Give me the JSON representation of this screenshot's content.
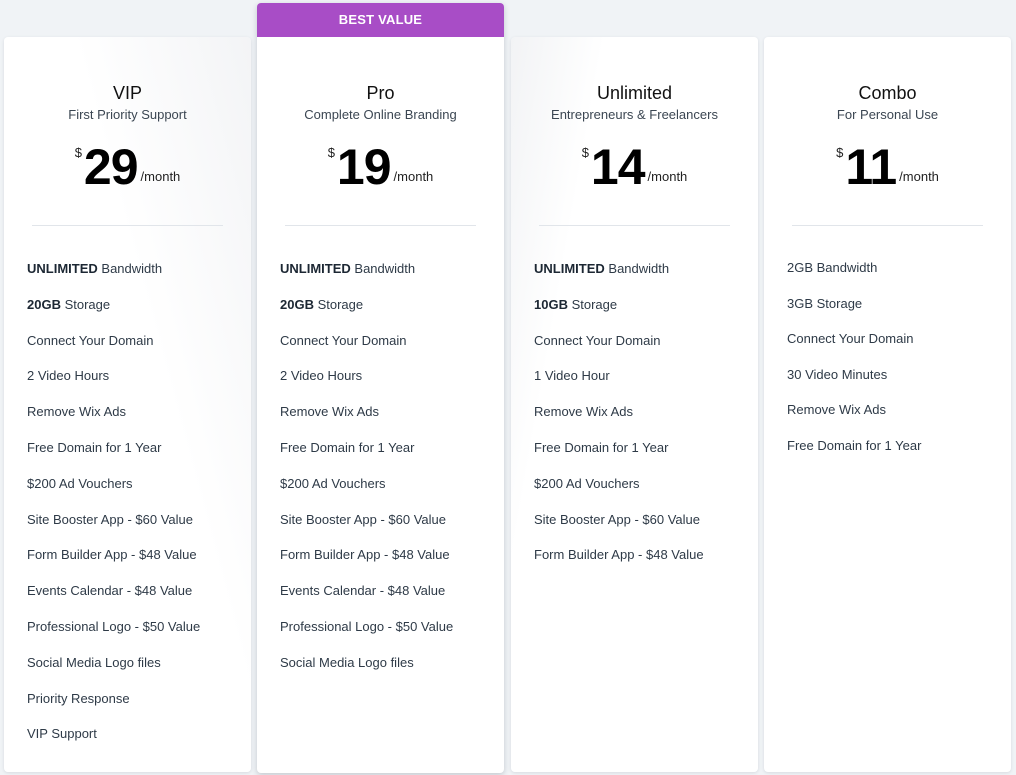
{
  "colors": {
    "background": "#f0f3f6",
    "ribbon": "#a84dc6",
    "card": "#ffffff"
  },
  "plans": [
    {
      "name": "VIP",
      "tagline": "First Priority Support",
      "currency": "$",
      "price": "29",
      "period": "/month",
      "features": [
        {
          "bold": "UNLIMITED",
          "text": " Bandwidth"
        },
        {
          "bold": "20GB",
          "text": " Storage"
        },
        {
          "bold": "",
          "text": "Connect Your Domain"
        },
        {
          "bold": "",
          "text": "2 Video Hours"
        },
        {
          "bold": "",
          "text": "Remove Wix Ads"
        },
        {
          "bold": "",
          "text": "Free Domain for 1 Year"
        },
        {
          "bold": "",
          "text": "$200 Ad Vouchers"
        },
        {
          "bold": "",
          "text": "Site Booster App - $60 Value"
        },
        {
          "bold": "",
          "text": "Form Builder App - $48 Value"
        },
        {
          "bold": "",
          "text": "Events Calendar - $48 Value"
        },
        {
          "bold": "",
          "text": "Professional Logo - $50 Value"
        },
        {
          "bold": "",
          "text": "Social Media Logo files"
        },
        {
          "bold": "",
          "text": "Priority Response"
        },
        {
          "bold": "",
          "text": "VIP Support"
        }
      ]
    },
    {
      "ribbon": "BEST VALUE",
      "name": "Pro",
      "tagline": "Complete Online Branding",
      "currency": "$",
      "price": "19",
      "period": "/month",
      "features": [
        {
          "bold": "UNLIMITED",
          "text": " Bandwidth"
        },
        {
          "bold": "20GB",
          "text": " Storage"
        },
        {
          "bold": "",
          "text": "Connect Your Domain"
        },
        {
          "bold": "",
          "text": "2 Video Hours"
        },
        {
          "bold": "",
          "text": "Remove Wix Ads"
        },
        {
          "bold": "",
          "text": "Free Domain for 1 Year"
        },
        {
          "bold": "",
          "text": "$200 Ad Vouchers"
        },
        {
          "bold": "",
          "text": "Site Booster App - $60 Value"
        },
        {
          "bold": "",
          "text": "Form Builder App - $48 Value"
        },
        {
          "bold": "",
          "text": "Events Calendar - $48 Value"
        },
        {
          "bold": "",
          "text": "Professional Logo - $50 Value"
        },
        {
          "bold": "",
          "text": "Social Media Logo files"
        }
      ]
    },
    {
      "name": "Unlimited",
      "tagline": "Entrepreneurs & Freelancers",
      "currency": "$",
      "price": "14",
      "period": "/month",
      "features": [
        {
          "bold": "UNLIMITED",
          "text": " Bandwidth"
        },
        {
          "bold": "10GB",
          "text": " Storage"
        },
        {
          "bold": "",
          "text": "Connect Your Domain"
        },
        {
          "bold": "",
          "text": "1 Video Hour"
        },
        {
          "bold": "",
          "text": "Remove Wix Ads"
        },
        {
          "bold": "",
          "text": "Free Domain for 1 Year"
        },
        {
          "bold": "",
          "text": "$200 Ad Vouchers"
        },
        {
          "bold": "",
          "text": "Site Booster App - $60 Value"
        },
        {
          "bold": "",
          "text": "Form Builder App - $48 Value"
        }
      ]
    },
    {
      "name": "Combo",
      "tagline": "For Personal Use",
      "currency": "$",
      "price": "11",
      "period": "/month",
      "features": [
        {
          "bold": "",
          "text": "2GB Bandwidth"
        },
        {
          "bold": "",
          "text": "3GB Storage"
        },
        {
          "bold": "",
          "text": "Connect Your Domain"
        },
        {
          "bold": "",
          "text": "30 Video Minutes"
        },
        {
          "bold": "",
          "text": "Remove Wix Ads"
        },
        {
          "bold": "",
          "text": "Free Domain for 1 Year"
        }
      ]
    }
  ]
}
